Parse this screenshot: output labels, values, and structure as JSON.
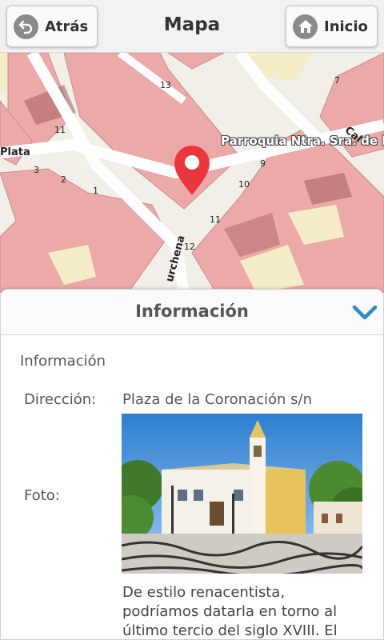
{
  "header": {
    "back_label": "Atrás",
    "title": "Mapa",
    "home_label": "Inicio"
  },
  "map": {
    "poi_label": "Parroquia Ntra. Sra. de l",
    "street_labels": [
      "Plata",
      "urchena",
      "Cal"
    ],
    "house_numbers": [
      "11",
      "13",
      "7",
      "3",
      "2",
      "1",
      "9",
      "10",
      "11",
      "12"
    ],
    "marker_color": "#e8383e"
  },
  "info": {
    "panel_title": "Información",
    "section_title": "Información",
    "address_label": "Dirección:",
    "address_value": "Plaza de la Coronación s/n",
    "photo_label": "Foto:",
    "description": "De estilo renacentista, podríamos datarla en torno al último tercio del siglo XVIII. El",
    "accent_color": "#2e8bc9"
  }
}
